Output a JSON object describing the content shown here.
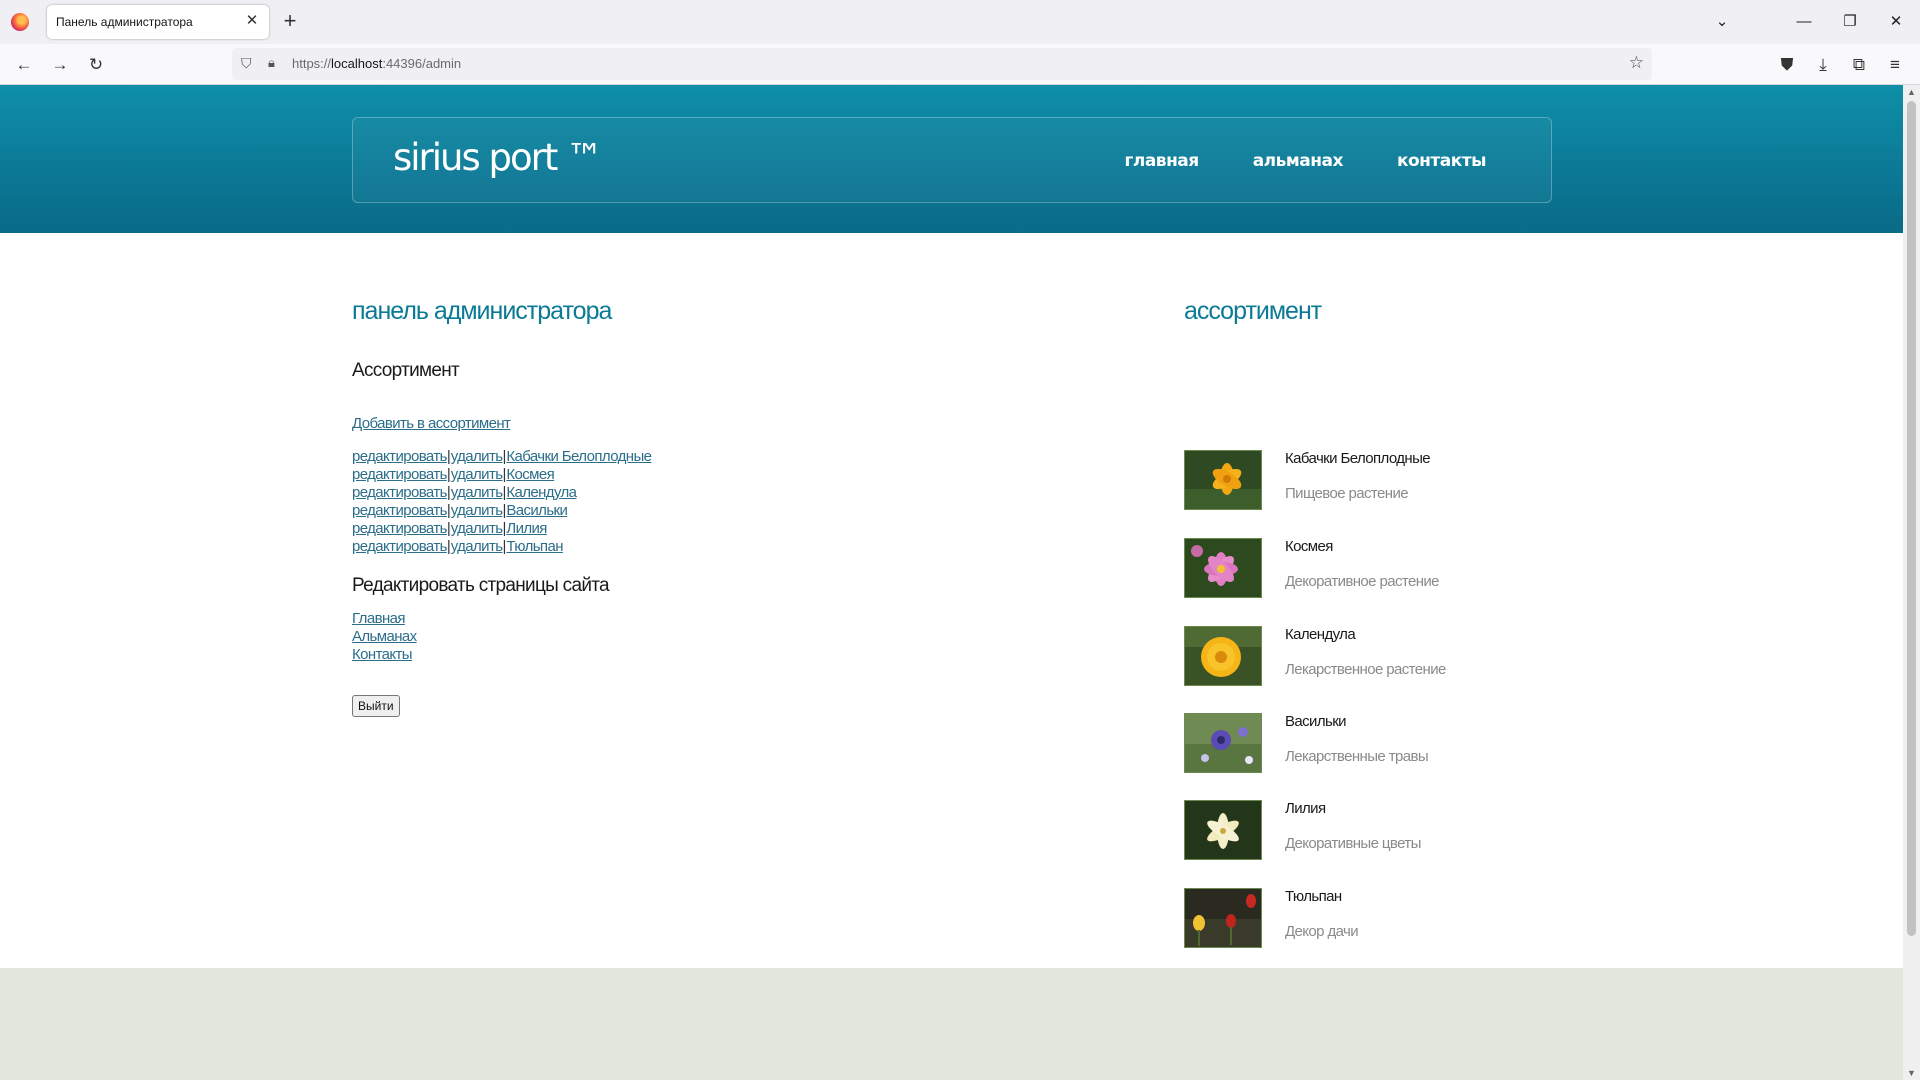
{
  "browser": {
    "tab_title": "Панель администратора",
    "tab_close": "✕",
    "new_tab": "+",
    "url_prefix": "https://",
    "url_host": "localhost",
    "url_rest": ":44396/admin"
  },
  "site": {
    "logo": "sirius port ™",
    "nav": [
      "главная",
      "альманах",
      "контакты"
    ]
  },
  "admin": {
    "title": "панель администратора",
    "assortment_heading": "Ассортимент",
    "add_link": "Добавить в ассортимент",
    "edit_label": "редактировать",
    "delete_label": "удалить",
    "separator": "|",
    "items": [
      "Кабачки Белоплодные",
      "Космея",
      "Календула",
      "Васильки",
      "Лилия",
      "Тюльпан"
    ],
    "pages_heading": "Редактировать страницы сайта",
    "pages": [
      "Главная",
      "Альманах",
      "Контакты"
    ],
    "logout_label": "Выйти"
  },
  "assortment": {
    "title": "ассортимент",
    "items": [
      {
        "name": "Кабачки Белоплодные",
        "desc": "Пищевое растение",
        "icon": "yellow-flower-photo"
      },
      {
        "name": "Космея",
        "desc": "Декоративное растение",
        "icon": "pink-flower-photo"
      },
      {
        "name": "Календула",
        "desc": "Лекарственное растение",
        "icon": "orange-flower-photo"
      },
      {
        "name": "Васильки",
        "desc": "Лекарственные травы",
        "icon": "purple-flower-photo"
      },
      {
        "name": "Лилия",
        "desc": "Декоративные цветы",
        "icon": "white-lily-photo"
      },
      {
        "name": "Тюльпан",
        "desc": "Декор дачи",
        "icon": "tulip-photo"
      }
    ]
  },
  "colors": {
    "header": "#0b7896",
    "accent": "#0a7a95",
    "link": "#2c6d8a",
    "footer": "#e2e6dc"
  }
}
